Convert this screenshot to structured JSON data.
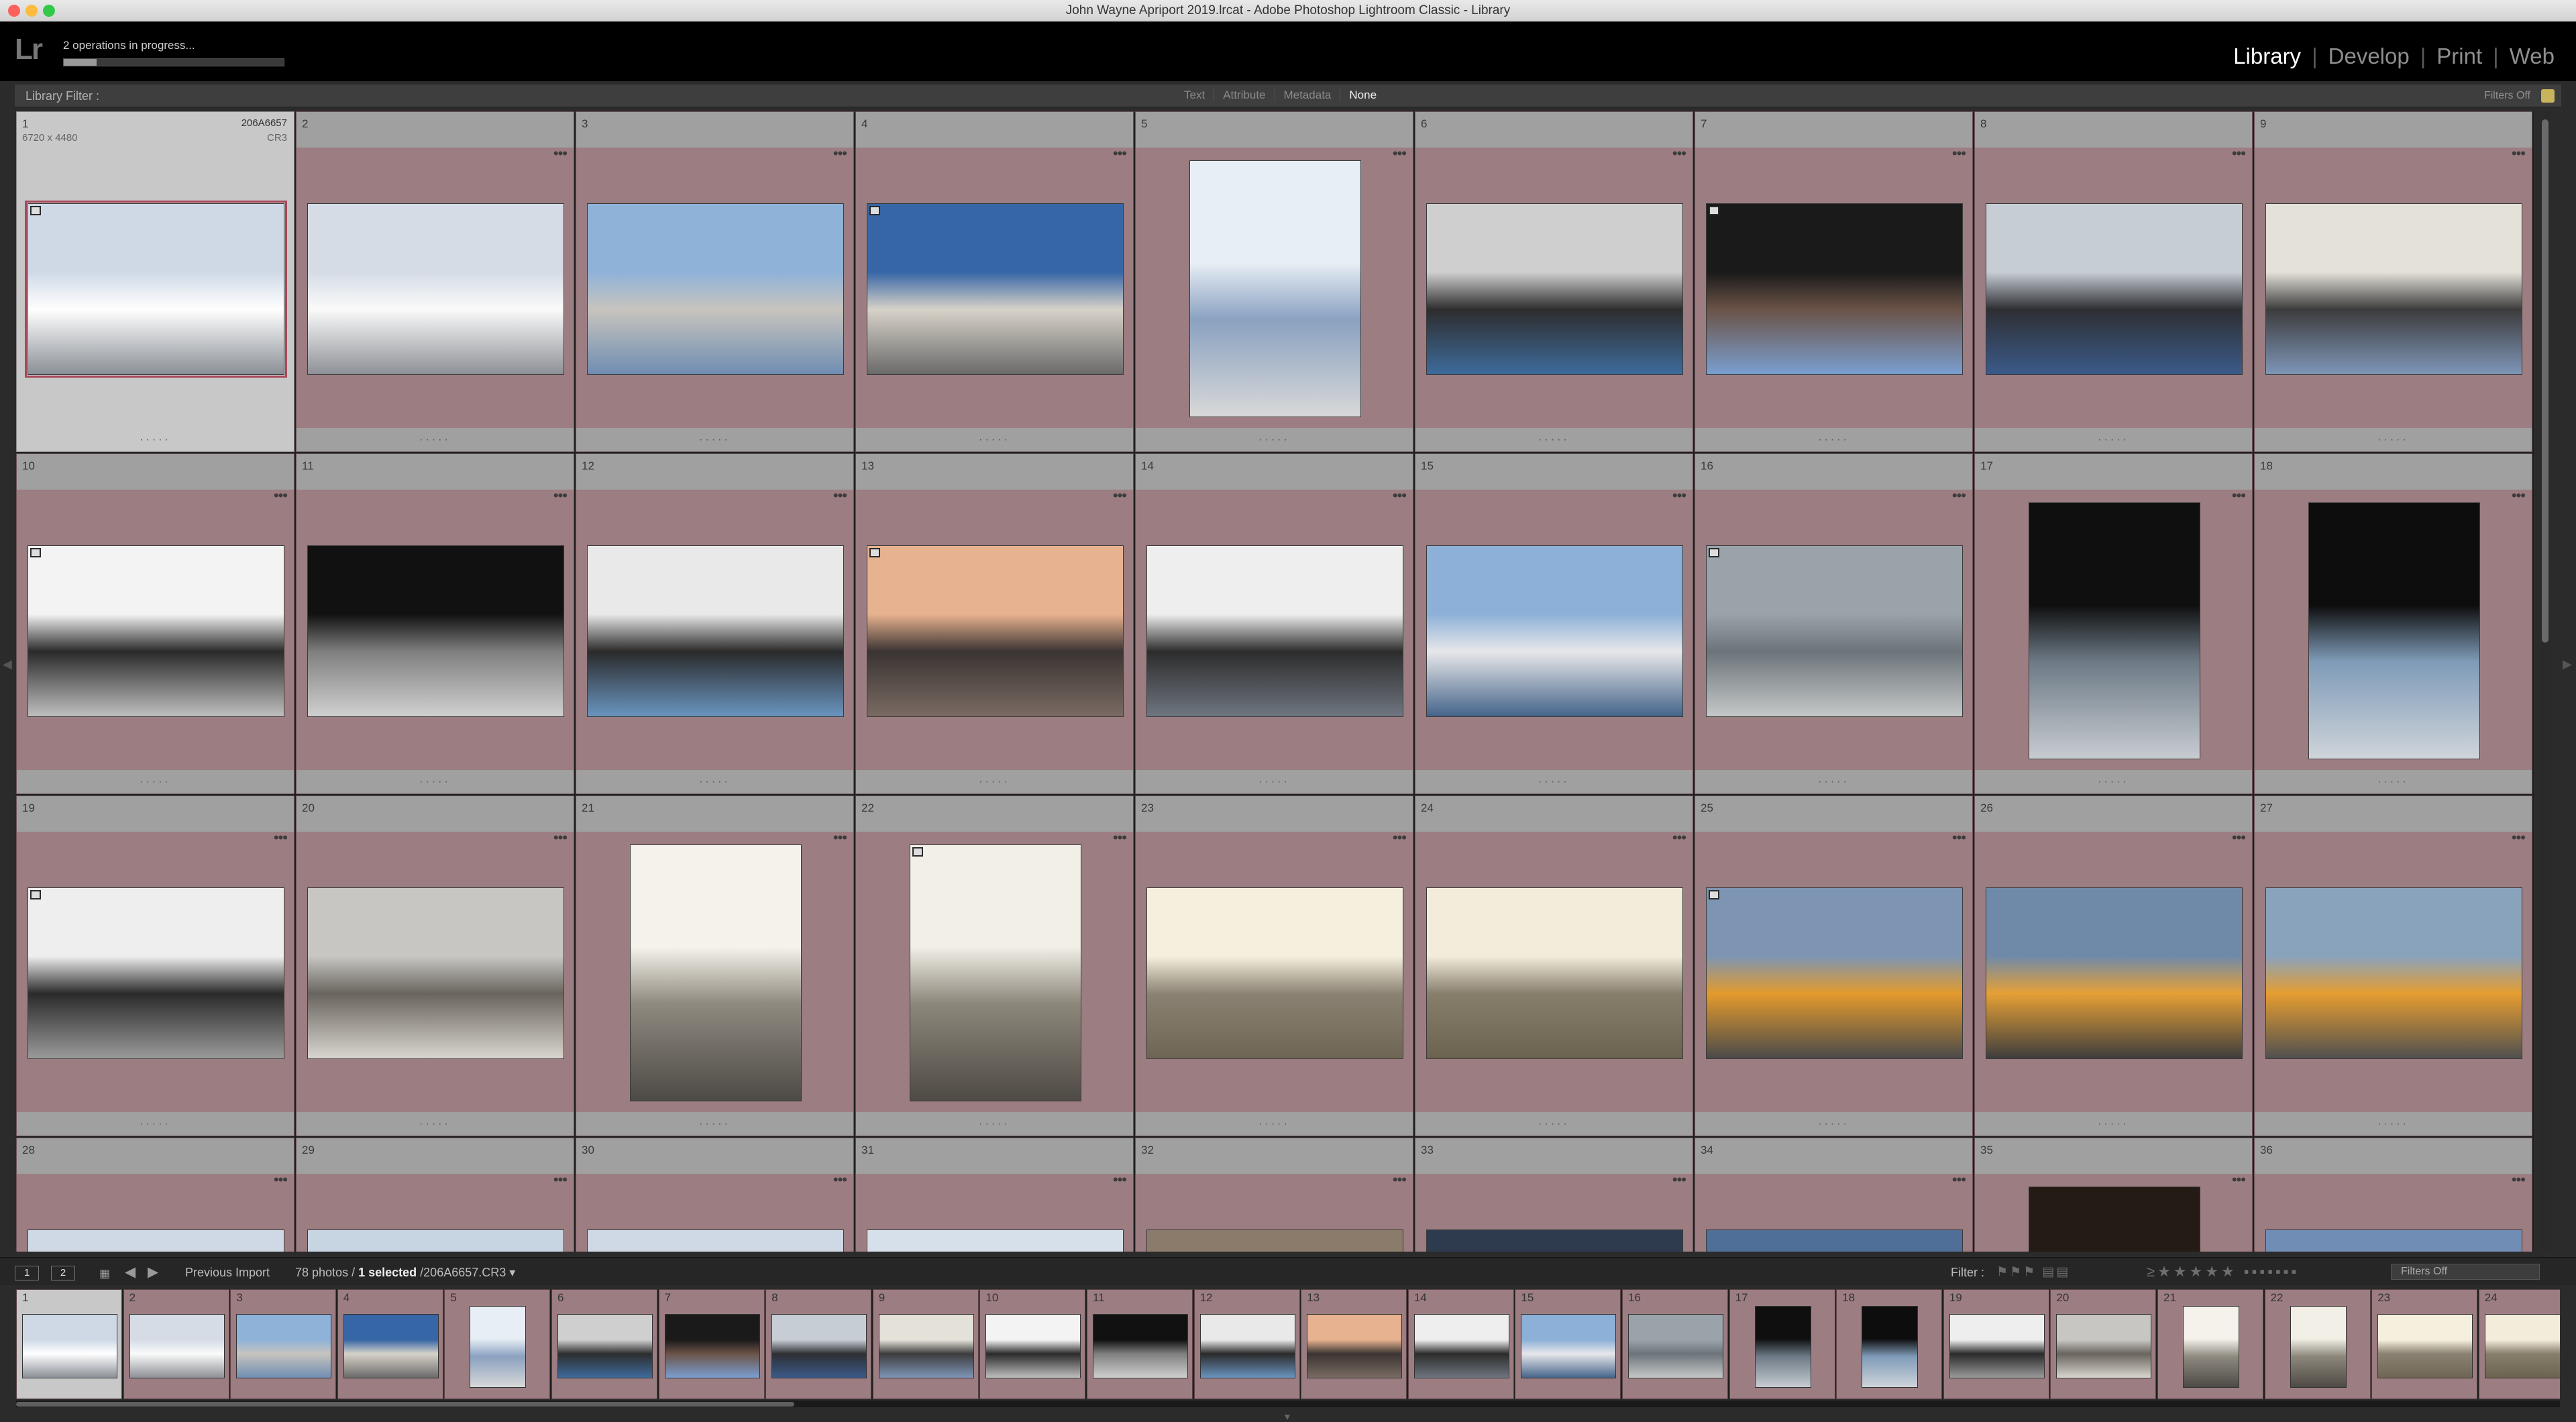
{
  "window": {
    "title": "John Wayne Apriport 2019.lrcat - Adobe Photoshop Lightroom Classic - Library",
    "traffic_lights": [
      "#fc605c",
      "#fdbc40",
      "#34c84a"
    ]
  },
  "header": {
    "logo": "Lr",
    "operations_text": "2 operations in progress...",
    "progress_fraction": 0.15,
    "modules": [
      "Library",
      "Develop",
      "Print",
      "Web"
    ],
    "active_module": "Library"
  },
  "filter_bar": {
    "label": "Library Filter :",
    "tabs": [
      "Text",
      "Attribute",
      "Metadata",
      "None"
    ],
    "active_tab": "None",
    "status": "Filters Off"
  },
  "selected_photo": {
    "number": "1",
    "filename": "206A6657",
    "dimensions": "6720 x 4480",
    "extension": "CR3"
  },
  "grid_cells": [
    {
      "num": "1",
      "orient": "landscape",
      "colors": [
        "#cfd9e6",
        "#ffffff",
        "#8a8f96"
      ]
    },
    {
      "num": "2",
      "orient": "landscape",
      "colors": [
        "#d5dce6",
        "#fafafa",
        "#8d9096"
      ]
    },
    {
      "num": "3",
      "orient": "landscape",
      "colors": [
        "#8fb2d9",
        "#c7c4be",
        "#6f8db2"
      ]
    },
    {
      "num": "4",
      "orient": "landscape",
      "colors": [
        "#3766a6",
        "#d7d2c8",
        "#6a6a6a"
      ]
    },
    {
      "num": "5",
      "orient": "portrait",
      "colors": [
        "#e7eef5",
        "#8aa1c0",
        "#d8d8d8"
      ]
    },
    {
      "num": "6",
      "orient": "landscape",
      "colors": [
        "#cfcfcf",
        "#2d2d2d",
        "#3e6b9c"
      ]
    },
    {
      "num": "7",
      "orient": "landscape",
      "colors": [
        "#1a1a1a",
        "#6b5347",
        "#7a9fd1"
      ]
    },
    {
      "num": "8",
      "orient": "landscape",
      "colors": [
        "#c7cdd5",
        "#2e2f33",
        "#3b5a8a"
      ]
    },
    {
      "num": "9",
      "orient": "landscape",
      "colors": [
        "#e4e1d8",
        "#3c3c3c",
        "#7f96b8"
      ]
    },
    {
      "num": "10",
      "orient": "landscape",
      "colors": [
        "#f3f3f3",
        "#2a2a2a",
        "#bfbfbf"
      ]
    },
    {
      "num": "11",
      "orient": "landscape",
      "colors": [
        "#111111",
        "#7f7f7f",
        "#d0d0d0"
      ]
    },
    {
      "num": "12",
      "orient": "landscape",
      "colors": [
        "#e9e9e9",
        "#2a2a2a",
        "#6a95c0"
      ]
    },
    {
      "num": "13",
      "orient": "landscape",
      "colors": [
        "#e7b28f",
        "#3a3432",
        "#7a6b63"
      ]
    },
    {
      "num": "14",
      "orient": "landscape",
      "colors": [
        "#eeeeee",
        "#2c2c2c",
        "#6f7680"
      ]
    },
    {
      "num": "15",
      "orient": "landscape",
      "colors": [
        "#8cb0d7",
        "#e7e7ea",
        "#45648a"
      ]
    },
    {
      "num": "16",
      "orient": "landscape",
      "colors": [
        "#9aa3aa",
        "#6c747a",
        "#c5c8c8"
      ]
    },
    {
      "num": "17",
      "orient": "portrait",
      "colors": [
        "#0f0f0f",
        "#6d7a86",
        "#c7ccd1"
      ]
    },
    {
      "num": "18",
      "orient": "portrait",
      "colors": [
        "#0d0d0d",
        "#7f9bb8",
        "#cfd4da"
      ]
    },
    {
      "num": "19",
      "orient": "landscape",
      "colors": [
        "#eeeeee",
        "#2a2a2a",
        "#9a9a9a"
      ]
    },
    {
      "num": "20",
      "orient": "landscape",
      "colors": [
        "#c7c6c3",
        "#69645d",
        "#d9d6cf"
      ]
    },
    {
      "num": "21",
      "orient": "portrait",
      "colors": [
        "#f4f2ea",
        "#8f8a80",
        "#4d4a45"
      ]
    },
    {
      "num": "22",
      "orient": "portrait",
      "colors": [
        "#f1efe6",
        "#8d877b",
        "#4e4a44"
      ]
    },
    {
      "num": "23",
      "orient": "landscape",
      "colors": [
        "#f5efdd",
        "#8a8272",
        "#6f6554"
      ]
    },
    {
      "num": "24",
      "orient": "landscape",
      "colors": [
        "#f3ecda",
        "#877e6c",
        "#6c6250"
      ]
    },
    {
      "num": "25",
      "orient": "landscape",
      "colors": [
        "#7d95b2",
        "#e39a2c",
        "#4a4a4a"
      ]
    },
    {
      "num": "26",
      "orient": "landscape",
      "colors": [
        "#6f8aa9",
        "#e6a035",
        "#3d3d3d"
      ]
    },
    {
      "num": "27",
      "orient": "landscape",
      "colors": [
        "#8aa3bd",
        "#e59d30",
        "#505050"
      ]
    },
    {
      "num": "28",
      "orient": "landscape",
      "colors": [
        "#cfd9e6",
        "#d08a2c",
        "#555555"
      ]
    },
    {
      "num": "29",
      "orient": "landscape",
      "colors": [
        "#c7d4e2",
        "#b9c3cc",
        "#888888"
      ]
    },
    {
      "num": "30",
      "orient": "landscape",
      "colors": [
        "#cfd9e6",
        "#dfe5ea",
        "#999999"
      ]
    },
    {
      "num": "31",
      "orient": "landscape",
      "colors": [
        "#d6e0ea",
        "#e4e8ec",
        "#999999"
      ]
    },
    {
      "num": "32",
      "orient": "landscape",
      "colors": [
        "#8a7b6a",
        "#c2b49b",
        "#555555"
      ]
    },
    {
      "num": "33",
      "orient": "landscape",
      "colors": [
        "#2e3a4d",
        "#586a82",
        "#1e2530"
      ]
    },
    {
      "num": "34",
      "orient": "landscape",
      "colors": [
        "#4f6e98",
        "#8fb0d5",
        "#2c3a4f"
      ]
    },
    {
      "num": "35",
      "orient": "portrait",
      "colors": [
        "#231b14",
        "#6b5a44",
        "#a08a66"
      ]
    },
    {
      "num": "36",
      "orient": "landscape",
      "colors": [
        "#6f8db5",
        "#9bb3cf",
        "#4a5c75"
      ]
    }
  ],
  "film_toolbar": {
    "page_buttons": [
      "1",
      "2"
    ],
    "source": "Previous Import",
    "count_prefix": "78 photos /",
    "selected_text": "1 selected",
    "path": "/206A6657.CR3",
    "filter_label": "Filter :",
    "filter_status": "Filters Off"
  },
  "filmstrip": [
    "1",
    "2",
    "3",
    "4",
    "5",
    "6",
    "7",
    "8",
    "9",
    "10",
    "11",
    "12",
    "13",
    "14",
    "15",
    "16",
    "17",
    "18",
    "19",
    "20",
    "21",
    "22",
    "23",
    "24"
  ]
}
